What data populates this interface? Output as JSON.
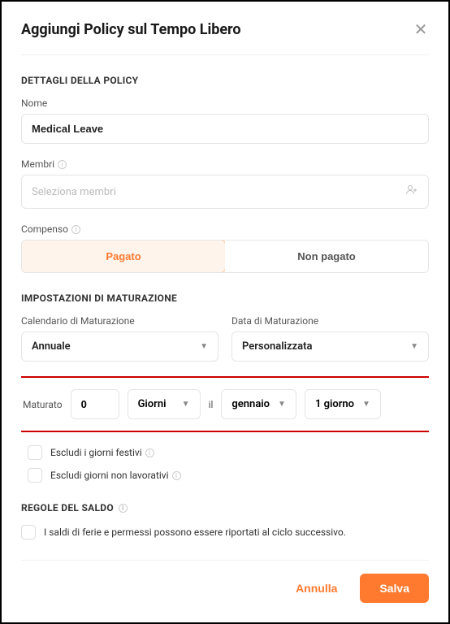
{
  "header": {
    "title": "Aggiungi Policy sul Tempo Libero"
  },
  "details": {
    "section_title": "DETTAGLI DELLA POLICY",
    "name_label": "Nome",
    "name_value": "Medical Leave",
    "members_label": "Membri",
    "members_placeholder": "Seleziona membri",
    "compensation_label": "Compenso",
    "paid_label": "Pagato",
    "unpaid_label": "Non pagato"
  },
  "accrual": {
    "section_title": "IMPOSTAZIONI DI MATURAZIONE",
    "schedule_label": "Calendario di Maturazione",
    "schedule_value": "Annuale",
    "date_label": "Data di Maturazione",
    "date_value": "Personalizzata",
    "accrued_label": "Maturato",
    "amount_value": "0",
    "unit_value": "Giorni",
    "on_label": "il",
    "month_value": "gennaio",
    "day_value": "1 giorno",
    "exclude_holidays": "Escludi i giorni festivi",
    "exclude_nonworking": "Escludi giorni non lavorativi"
  },
  "balance": {
    "section_title": "REGOLE DEL SALDO",
    "rollover_label": "I saldi di ferie e permessi possono essere riportati al ciclo successivo."
  },
  "footer": {
    "cancel": "Annulla",
    "save": "Salva"
  }
}
